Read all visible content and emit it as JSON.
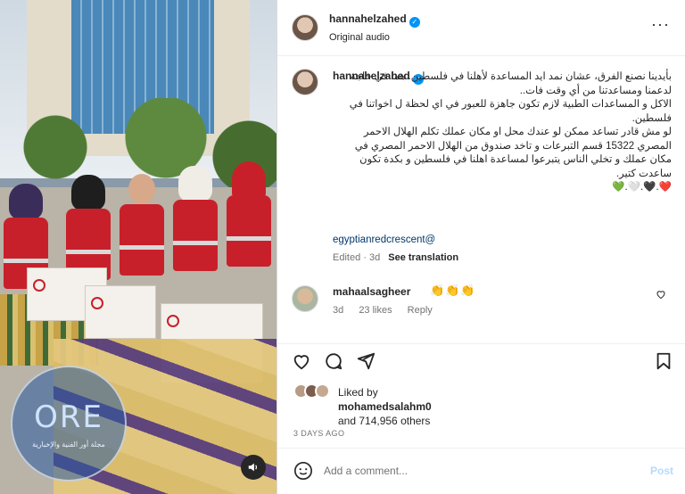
{
  "post": {
    "username": "hannahelzahed",
    "audio": "Original audio"
  },
  "caption": {
    "username": "hannahelzahed",
    "text": "بأيدينا نصنع الفرق، عشان نمد ايد المساعدة لأهلنا في فلسطين. هما في حاجة لدعمنا ومساعدتنا من أي وقت فات..\nالاكل و المساعدات الطبية لازم تكون جاهزة للعبور في اي لحظة ل اخواتنا في فلسطين.\nلو مش قادر تساعد ممكن لو عندك محل او مكان عملك تكلم الهلال الاحمر المصري 15322 قسم التبرعات و تاخد صندوق من الهلال الاحمر المصري في مكان عملك و تخلي الناس يتبرعوا لمساعدة اهلنا في فلسطين و بكدة تكون ساعدت كتير.\n❤️.🖤.🤍.💚",
    "mention": "egyptianredcrescent@",
    "edited": "Edited · 3d",
    "see_translation": "See translation"
  },
  "comment": {
    "username": "mahaalsagheer",
    "emoji": "👏👏👏",
    "age": "3d",
    "likes": "23 likes",
    "reply": "Reply"
  },
  "likes": {
    "liked_by": "Liked by",
    "liker": "mohamedsalahm0",
    "and_others": "and 714,956 others"
  },
  "date": "3 DAYS AGO",
  "add_comment": {
    "placeholder": "Add a comment...",
    "post_label": "Post"
  },
  "watermark": {
    "title": "ORE",
    "subtitle": "مجلة أور الفنية والإخبارية"
  },
  "icons": [
    "verified-icon",
    "more-icon",
    "heart-icon",
    "comment-icon",
    "share-icon",
    "save-icon",
    "smile-icon",
    "sound-icon"
  ],
  "colors": {
    "accent": "#0095f6",
    "link": "#00376b",
    "red_crescent": "#c8202a",
    "post_disabled": "#b3dbff"
  }
}
